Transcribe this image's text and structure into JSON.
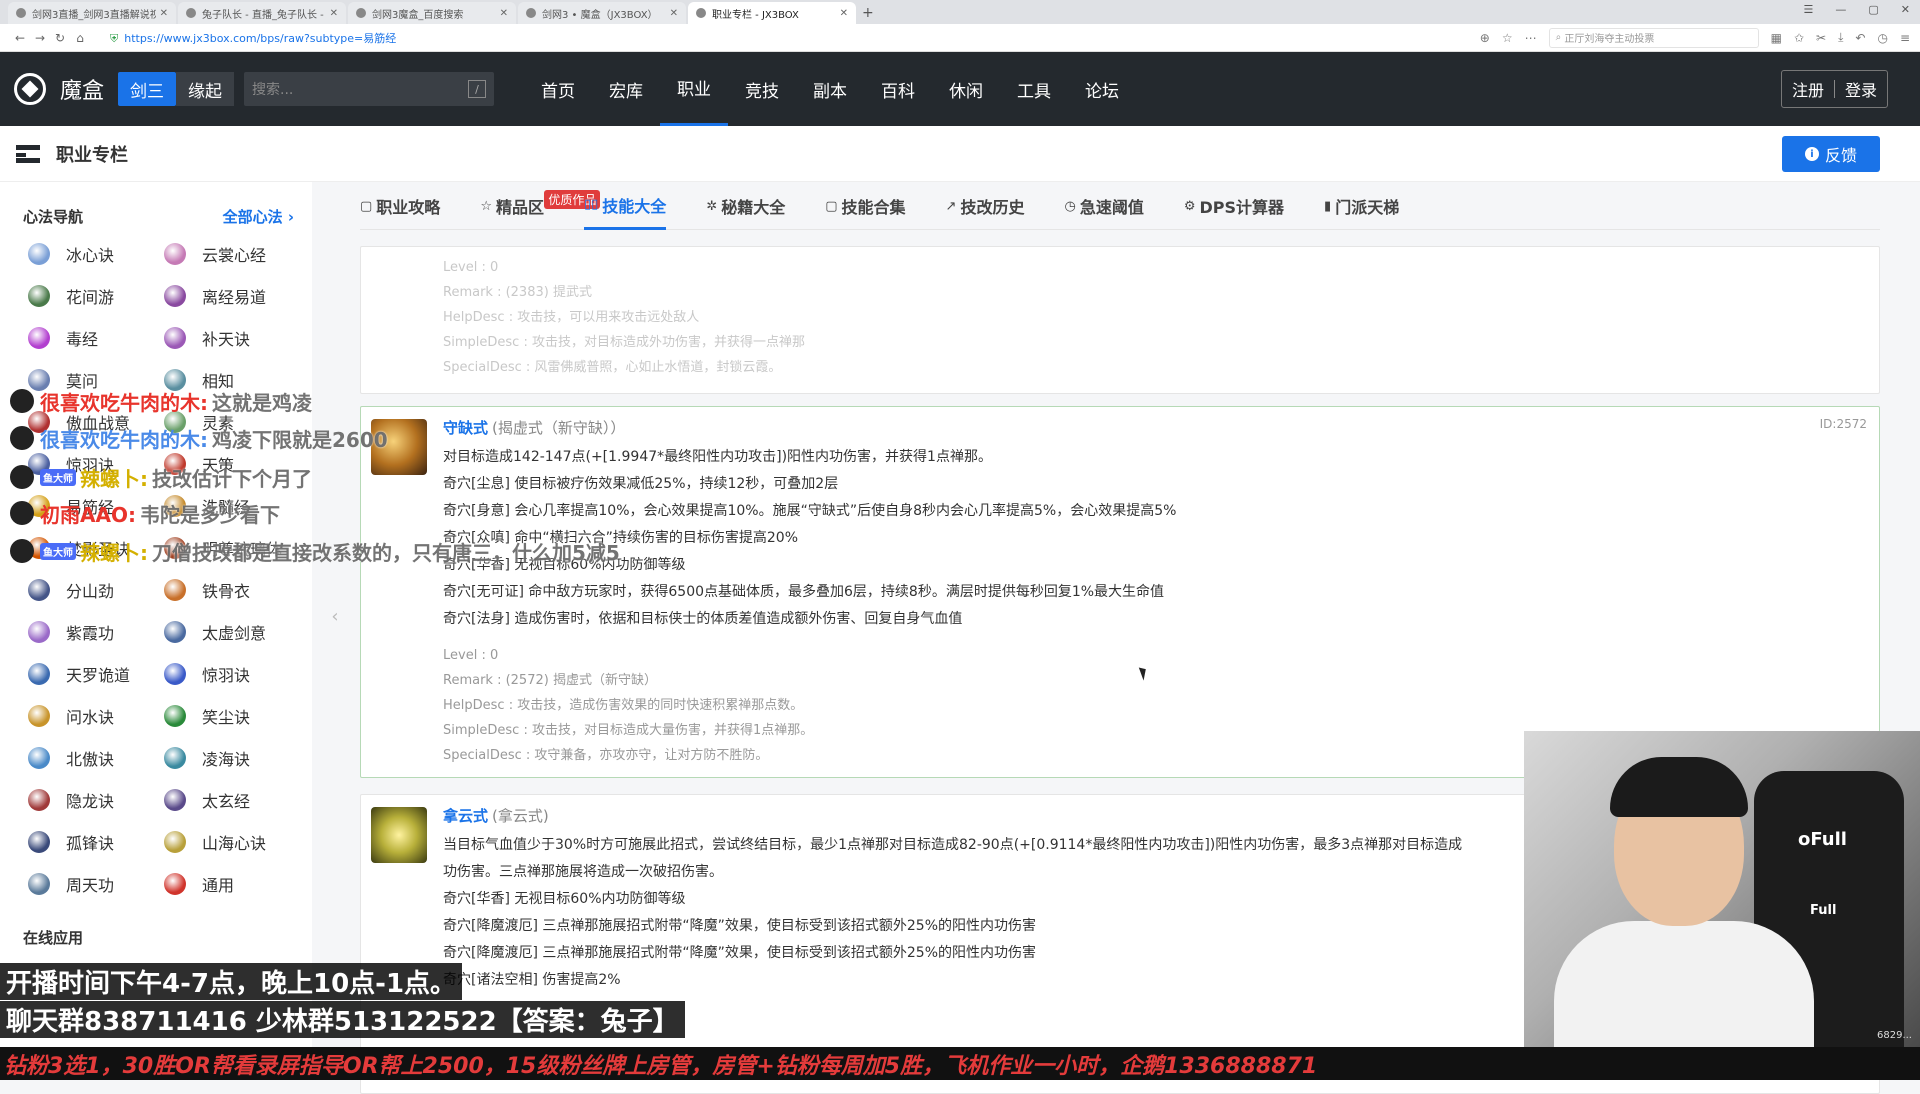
{
  "browser": {
    "tabs": [
      {
        "label": "剑网3直播_剑网3直播解说视"
      },
      {
        "label": "兔子队长 - 直播_兔子队长 -"
      },
      {
        "label": "剑网3魔盒_百度搜索"
      },
      {
        "label": "剑网3 • 魔盒（JX3BOX）"
      },
      {
        "label": "职业专栏 - JX3BOX"
      }
    ],
    "new_tab": "+",
    "url": "https://www.jx3box.com/bps/raw?subtype=易筋经",
    "search_placeholder": "正厅刘海夺主动投票"
  },
  "header": {
    "logo_text": "魔盒",
    "game_on": "剑三",
    "game_off": "缘起",
    "search_placeholder": "搜索...",
    "search_shortcut": "/",
    "nav": [
      "首页",
      "宏库",
      "职业",
      "竞技",
      "副本",
      "百科",
      "休闲",
      "工具",
      "论坛"
    ],
    "register": "注册",
    "login": "登录"
  },
  "subheader": {
    "title": "职业专栏",
    "feedback": "反馈"
  },
  "sidebar": {
    "title": "心法导航",
    "all_link": "全部心法 ›",
    "schools": [
      {
        "name": "冰心诀",
        "color": "#7a9fd6"
      },
      {
        "name": "云裳心经",
        "color": "#c57ab5"
      },
      {
        "name": "花间游",
        "color": "#4a7a4a"
      },
      {
        "name": "离经易道",
        "color": "#8a4aa0"
      },
      {
        "name": "毒经",
        "color": "#b23fcf"
      },
      {
        "name": "补天诀",
        "color": "#9b59b6"
      },
      {
        "name": "莫问",
        "color": "#6a7fb0"
      },
      {
        "name": "相知",
        "color": "#5a8fa0"
      },
      {
        "name": "傲血战意",
        "color": "#b03030"
      },
      {
        "name": "灵素",
        "color": "#6aa06a"
      },
      {
        "name": "惊羽诀",
        "color": "#4a5fa0"
      },
      {
        "name": "天策",
        "color": "#c0392b"
      },
      {
        "name": "易筋经",
        "color": "#d4a017"
      },
      {
        "name": "洗髓经",
        "color": "#c58a2a"
      },
      {
        "name": "焚影圣诀",
        "color": "#d35400"
      },
      {
        "name": "明尊琉璃体",
        "color": "#a04020"
      },
      {
        "name": "分山劲",
        "color": "#445588"
      },
      {
        "name": "铁骨衣",
        "color": "#c8702a"
      },
      {
        "name": "紫霞功",
        "color": "#9a6ac8"
      },
      {
        "name": "太虚剑意",
        "color": "#4a6aa0"
      },
      {
        "name": "天罗诡道",
        "color": "#3a6ab0"
      },
      {
        "name": "惊羽诀",
        "color": "#3a5ac8"
      },
      {
        "name": "问水诀",
        "color": "#c8942a"
      },
      {
        "name": "笑尘诀",
        "color": "#2a8a3a"
      },
      {
        "name": "北傲诀",
        "color": "#4a8ac8"
      },
      {
        "name": "凌海诀",
        "color": "#3a8aa0"
      },
      {
        "name": "隐龙诀",
        "color": "#a03a3a"
      },
      {
        "name": "太玄经",
        "color": "#5a4a8a"
      },
      {
        "name": "孤锋诀",
        "color": "#3a4a7a"
      },
      {
        "name": "山海心诀",
        "color": "#b8a03a"
      },
      {
        "name": "周天功",
        "color": "#5a7a9a"
      },
      {
        "name": "通用",
        "color": "#d0342c"
      }
    ],
    "section2": "在线应用"
  },
  "main_tabs": [
    {
      "icon": "▢",
      "label": "职业攻略"
    },
    {
      "icon": "☆",
      "label": "精品区",
      "badge": "优质作品"
    },
    {
      "icon": "▯▯",
      "label": "技能大全",
      "active": true
    },
    {
      "icon": "✲",
      "label": "秘籍大全"
    },
    {
      "icon": "▢",
      "label": "技能合集"
    },
    {
      "icon": "↗",
      "label": "技改历史"
    },
    {
      "icon": "◷",
      "label": "急速阈值"
    },
    {
      "icon": "⚙",
      "label": "DPS计算器"
    },
    {
      "icon": "▮",
      "label": "门派天梯"
    }
  ],
  "skills": {
    "prev": {
      "meta": [
        "Level : 0",
        "Remark : (2383) 提武式",
        "HelpDesc : 攻击技，可以用来攻击远处敌人",
        "SimpleDesc : 攻击技，对目标造成外功伤害，并获得一点禅那",
        "SpecialDesc : 风雷佛威普照，心如止水悟道，封锁云霞。"
      ]
    },
    "shouque": {
      "name": "守缺式",
      "alias": "(揭虚式（新守缺））",
      "id": "ID:2572",
      "lines": [
        "对目标造成142-147点(+[1.9947*最终阳性内功攻击])阳性内功伤害，并获得1点禅那。",
        "奇穴[尘息] 使目标被疗伤效果减低25%，持续12秒，可叠加2层",
        "奇穴[身意] 会心几率提高10%，会心效果提高10%。施展“守缺式”后使自身8秒内会心几率提高5%，会心效果提高5%",
        "奇穴[众嗔] 命中“横扫六合”持续伤害的目标伤害提高20%",
        "奇穴[华香] 无视目标60%内功防御等级",
        "奇穴[无可证] 命中敌方玩家时，获得6500点基础体质，最多叠加6层，持续8秒。满层时提供每秒回复1%最大生命值",
        "奇穴[法身] 造成伤害时，依据和目标侠士的体质差值造成额外伤害、回复自身气血值"
      ],
      "meta": [
        "Level : 0",
        "Remark : (2572) 揭虚式（新守缺）",
        "HelpDesc : 攻击技，造成伤害效果的同时快速积累禅那点数。",
        "SimpleDesc : 攻击技，对目标造成大量伤害，并获得1点禅那。",
        "SpecialDesc : 攻守兼备，亦攻亦守，让对方防不胜防。"
      ]
    },
    "nayun": {
      "name": "拿云式",
      "alias": "(拿云式)",
      "lines": [
        "当目标气血值少于30%时方可施展此招式，尝试终结目标，最少1点禅那对目标造成82-90点(+[0.9114*最终阳性内功攻击])阳性内功伤害，最多3点禅那对目标造成",
        "功伤害。三点禅那施展将造成一次破招伤害。",
        "奇穴[华香] 无视目标60%内功防御等级",
        "奇穴[降魔渡厄] 三点禅那施展招式附带“降魔”效果，使目标受到该招式额外25%的阳性内功伤害",
        "奇穴[降魔渡厄] 三点禅那施展招式附带“降魔”效果，使目标受到该招式额外25%的阳性内功伤害",
        "奇穴[诸法空相] 伤害提高2%"
      ]
    }
  },
  "stream": {
    "danmaku": [
      {
        "name": "很喜欢吃牛肉的木:",
        "msg": "这就是鸡凌",
        "color": "#e8342c",
        "fan": ""
      },
      {
        "name": "很喜欢吃牛肉的木:",
        "msg": "鸡凌下限就是2600",
        "color": "#4a8ae8",
        "fan": ""
      },
      {
        "name": "辣螺卜:",
        "msg": "技改估计下个月了",
        "color": "#d4b000",
        "fan": "鱼大师"
      },
      {
        "name": "初雨AAO:",
        "msg": "韦陀是多少看下",
        "color": "#e8342c",
        "fan": ""
      },
      {
        "name": "辣螺卜:",
        "msg": "刀僧技改都是直接改系数的，只有唐三，什么加5减5",
        "color": "#d4b000",
        "fan": "鱼大师"
      }
    ],
    "notice1": "开播时间下午4-7点，晚上10点-1点。",
    "notice2": "聊天群838711416 少林群513122522【答案：兔子】",
    "ticker": "钻粉3选1，30胜OR帮看录屏指导OR帮上2500，15级粉丝牌上房管，房管+钻粉每周加5胜，飞机作业一小时，企鹅1336888871",
    "chair_text_1": "oFull",
    "chair_text_2": "Full",
    "watermark": "6829..."
  },
  "colors": {
    "accent": "#1a73e8",
    "header_bg": "#24292e",
    "badge": "#e03c3c"
  }
}
